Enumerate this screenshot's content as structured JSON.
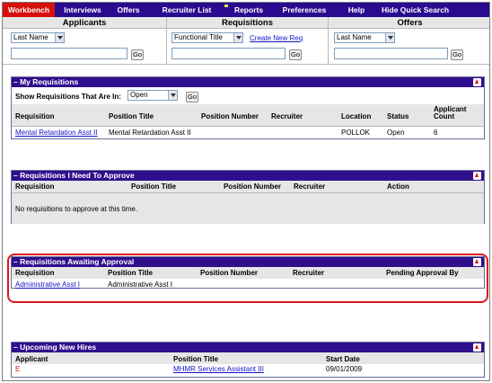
{
  "nav": {
    "tabs": [
      "Workbench",
      "Interviews",
      "Offers",
      "Recruiter List",
      "Reports",
      "Preferences",
      "Help",
      "Hide Quick Search"
    ]
  },
  "quick_search": {
    "headers": [
      "Applicants",
      "Requisitions",
      "Offers"
    ],
    "applicants_field": "Last Name",
    "requisitions_field": "Functional Title",
    "offers_field": "Last Name",
    "create_link": "Create New Req",
    "go": "Go"
  },
  "my_requisitions": {
    "title": "My Requisitions",
    "filter_label": "Show Requisitions That Are In:",
    "filter_value": "Open",
    "go": "Go",
    "columns": [
      "Requisition",
      "Position Title",
      "Position Number",
      "Recruiter",
      "Location",
      "Status",
      "Applicant",
      "Count"
    ],
    "row": {
      "requisition": "Mental Retardation Asst II",
      "position_title": "Mental Retardation Asst II",
      "location": "POLLOK",
      "status": "Open",
      "count": "6"
    }
  },
  "to_approve": {
    "title": "Requisitions I Need To Approve",
    "columns": [
      "Requisition",
      "Position Title",
      "Position Number",
      "Recruiter",
      "Action"
    ],
    "empty": "No requisitions to approve at this time."
  },
  "awaiting": {
    "title": "Requisitions Awaiting Approval",
    "columns": [
      "Requisition",
      "Position Title",
      "Position Number",
      "Recruiter",
      "Pending Approval By"
    ],
    "row": {
      "requisition": "Administrative Asst I",
      "position_title": "Administrative Asst I"
    }
  },
  "new_hires": {
    "title": "Upcoming New Hires",
    "columns": [
      "Applicant",
      "Position Title",
      "Start Date"
    ],
    "row": {
      "applicant": "E",
      "position_title": "MHMR Services Assistant III",
      "start_date": "09/01/2009"
    }
  },
  "colors": {
    "nav_bg": "#2a0a8e",
    "active_tab": "#d7100b",
    "panel_header": "#2f0f8c",
    "highlight": "#e0161c",
    "link": "#1414c8"
  }
}
